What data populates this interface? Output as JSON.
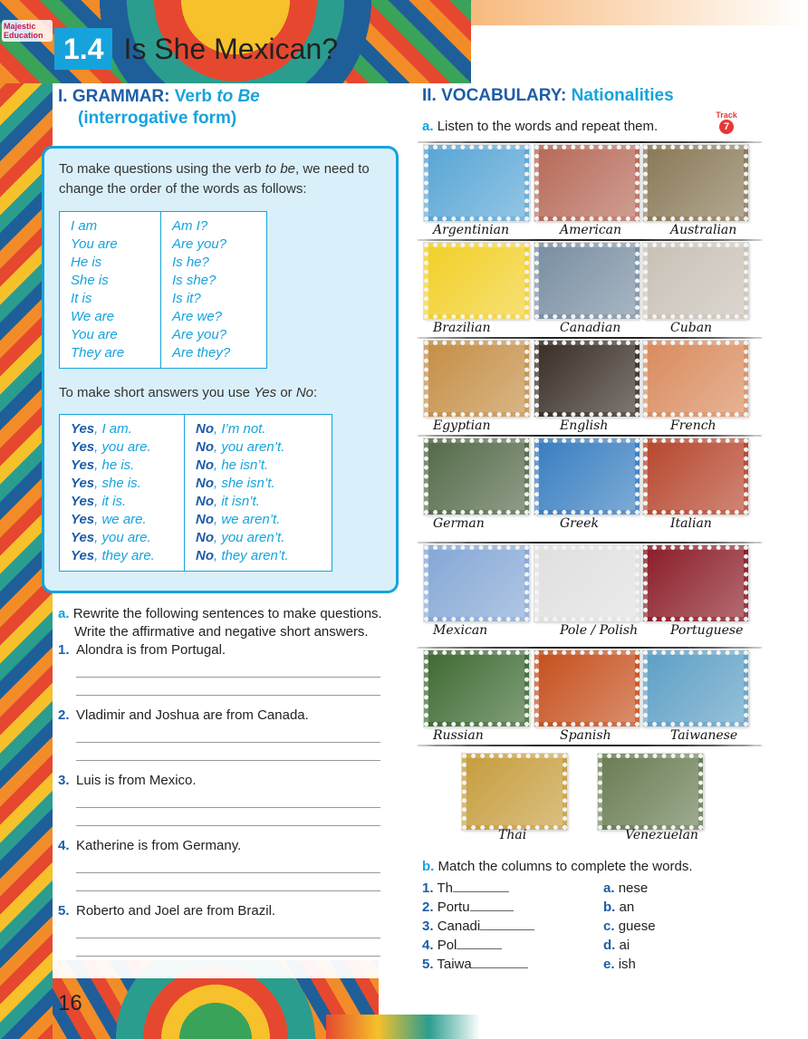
{
  "logo": "Majestic Education",
  "lesson": {
    "number": "1.4",
    "title": "Is She Mexican?"
  },
  "grammar": {
    "heading": "I. GRAMMAR:",
    "sub1": "Verb",
    "sub_em": "to Be",
    "sub2": "(interrogative form)",
    "intro1": "To make questions using the verb",
    "intro_em": "to be",
    "intro2": ", we need to change the order of the words as follows:",
    "statements": [
      "I am",
      "You are",
      "He is",
      "She is",
      "It is",
      "We are",
      "You are",
      "They are"
    ],
    "questions": [
      "Am I?",
      "Are you?",
      "Is he?",
      "Is she?",
      "Is it?",
      "Are we?",
      "Are you?",
      "Are they?"
    ],
    "short_intro1": "To make short answers you use",
    "short_yes": "Yes",
    "short_or": "or",
    "short_no": "No",
    "short_colon": ":",
    "yes_word": "Yes",
    "no_word": "No",
    "yes_rest": [
      ", I am.",
      ", you are.",
      ", he is.",
      ", she is.",
      ", it is.",
      ", we are.",
      ", you are.",
      ", they are."
    ],
    "no_rest": [
      ", I’m not.",
      ", you aren’t.",
      ", he isn’t.",
      ", she isn’t.",
      ", it isn’t.",
      ", we aren’t.",
      ", you aren’t.",
      ", they aren’t."
    ]
  },
  "exercise_a": {
    "letter": "a.",
    "instruction": "Rewrite the following sentences to make questions. Write the affirmative and negative short answers.",
    "items": [
      {
        "n": "1.",
        "text": "Alondra is from Portugal."
      },
      {
        "n": "2.",
        "text": "Vladimir and Joshua are from Canada."
      },
      {
        "n": "3.",
        "text": "Luis is from Mexico."
      },
      {
        "n": "4.",
        "text": "Katherine is from Germany."
      },
      {
        "n": "5.",
        "text": "Roberto and Joel are from Brazil."
      }
    ]
  },
  "page_number": "16",
  "vocabulary": {
    "heading": "II. VOCABULARY:",
    "sub": "Nationalities",
    "a_letter": "a.",
    "a_text": "Listen to the words and repeat them.",
    "track_label": "Track",
    "track_number": "7",
    "nationalities": [
      "Argentinian",
      "American",
      "Australian",
      "Brazilian",
      "Canadian",
      "Cuban",
      "Egyptian",
      "English",
      "French",
      "German",
      "Greek",
      "Italian",
      "Mexican",
      "Pole / Polish",
      "Portuguese",
      "Russian",
      "Spanish",
      "Taiwanese",
      "Thai",
      "Venezuelan"
    ],
    "photo_colors": [
      "#5aa6d6",
      "#b76b5a",
      "#8a7a58",
      "#f2d02a",
      "#7a8fa3",
      "#c9c1b6",
      "#c58f47",
      "#3b3028",
      "#d98c5f",
      "#556b4a",
      "#3a7fc1",
      "#b7482f",
      "#86a8d6",
      "#e0e0e0",
      "#8c1f2a",
      "#3f6b34",
      "#c6511f",
      "#5fa0c6",
      "#c79e3f",
      "#6a7e55"
    ]
  },
  "exercise_b": {
    "letter": "b.",
    "instruction": "Match the columns to complete the words.",
    "left": [
      {
        "n": "1.",
        "text": "Th"
      },
      {
        "n": "2.",
        "text": "Portu"
      },
      {
        "n": "3.",
        "text": "Canadi"
      },
      {
        "n": "4.",
        "text": "Pol"
      },
      {
        "n": "5.",
        "text": "Taiwa"
      }
    ],
    "right": [
      {
        "n": "a.",
        "text": "nese"
      },
      {
        "n": "b.",
        "text": "an"
      },
      {
        "n": "c.",
        "text": "guese"
      },
      {
        "n": "d.",
        "text": "ai"
      },
      {
        "n": "e.",
        "text": "ish"
      }
    ]
  }
}
